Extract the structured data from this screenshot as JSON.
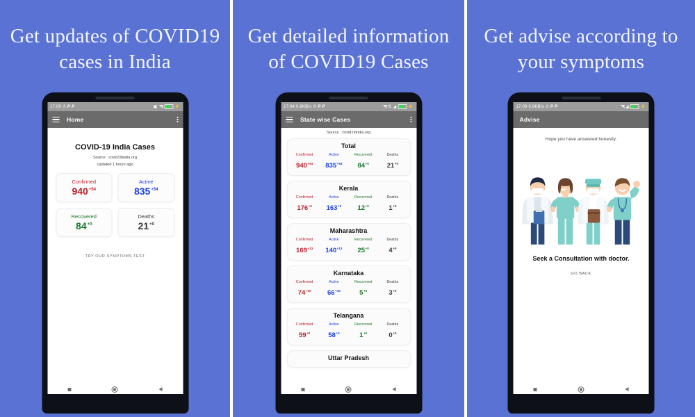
{
  "theme": {
    "panel_bg": "#5a72d4",
    "confirmed_color": "#c0202a",
    "active_color": "#1a41e8",
    "recovered_color": "#1b7a2a",
    "deaths_color": "#3b3b3b",
    "appbar_bg": "#6b6b6b",
    "statusbar_bg": "#9c9c9c"
  },
  "panels": [
    {
      "headline": "Get updates of COVID19 cases in India"
    },
    {
      "headline": "Get detailed information of COVID19 Cases"
    },
    {
      "headline": "Get advise according to your symptoms"
    }
  ],
  "screen1": {
    "status": {
      "time": "17:00",
      "alarm_icon": "alarm-icon",
      "app_icon_1": "P",
      "app_icon_2": "P"
    },
    "appbar": {
      "menu_icon": "hamburger-menu-icon",
      "title": "Home",
      "overflow_icon": "kebab-menu-icon"
    },
    "title": "COVID-19 India Cases",
    "source": "Source : covid19india.org",
    "updated": "Updated  1 hours ago",
    "cards": [
      {
        "label": "Confirmed",
        "value": "940",
        "delta": "+54",
        "key": "conf"
      },
      {
        "label": "Active",
        "value": "835",
        "delta": "+54",
        "key": "act"
      },
      {
        "label": "Recovered",
        "value": "84",
        "delta": "+0",
        "key": "rec"
      },
      {
        "label": "Deaths",
        "value": "21",
        "delta": "+0",
        "key": "dea"
      }
    ],
    "cta": "TRY OUR SYMPTOMS TEST"
  },
  "screen2": {
    "status": {
      "time": "17:04",
      "speed": "0.8KB/s",
      "alarm_icon": "alarm-icon",
      "app_icon_1": "P",
      "app_icon_2": "P"
    },
    "appbar": {
      "menu_icon": "hamburger-menu-icon",
      "title": "State wise Cases",
      "overflow_icon": "kebab-menu-icon"
    },
    "source": "Source : covid19india.org",
    "column_labels": [
      "Confirmed",
      "Active",
      "Recovered",
      "Deaths"
    ],
    "states": [
      {
        "name": "Total",
        "confirmed": "940",
        "confirmed_delta": "+54",
        "active": "835",
        "active_delta": "+54",
        "recovered": "84",
        "recovered_delta": "+0",
        "deaths": "21",
        "deaths_delta": "+0"
      },
      {
        "name": "Kerala",
        "confirmed": "176",
        "confirmed_delta": "+0",
        "active": "163",
        "active_delta": "+0",
        "recovered": "12",
        "recovered_delta": "+0",
        "deaths": "1",
        "deaths_delta": "+0"
      },
      {
        "name": "Maharashtra",
        "confirmed": "169",
        "confirmed_delta": "+13",
        "active": "140",
        "active_delta": "+13",
        "recovered": "25",
        "recovered_delta": "+0",
        "deaths": "4",
        "deaths_delta": "+0"
      },
      {
        "name": "Karnataka",
        "confirmed": "74",
        "confirmed_delta": "+10",
        "active": "66",
        "active_delta": "+10",
        "recovered": "5",
        "recovered_delta": "+0",
        "deaths": "3",
        "deaths_delta": "+0"
      },
      {
        "name": "Telangana",
        "confirmed": "59",
        "confirmed_delta": "+0",
        "active": "58",
        "active_delta": "+0",
        "recovered": "1",
        "recovered_delta": "+0",
        "deaths": "0",
        "deaths_delta": "+0"
      }
    ],
    "next_state_partial": "Uttar Pradesh"
  },
  "screen3": {
    "status": {
      "time": "17:09",
      "speed": "0.9KB/s",
      "alarm_icon": "alarm-icon",
      "app_icon_1": "P",
      "app_icon_2": "P"
    },
    "appbar": {
      "title": "Advise"
    },
    "note": "Hope you have answered honestly.",
    "illustration": "doctors-group-illustration",
    "seek": "Seek a Consultation with doctor.",
    "back": "GO BACK"
  }
}
